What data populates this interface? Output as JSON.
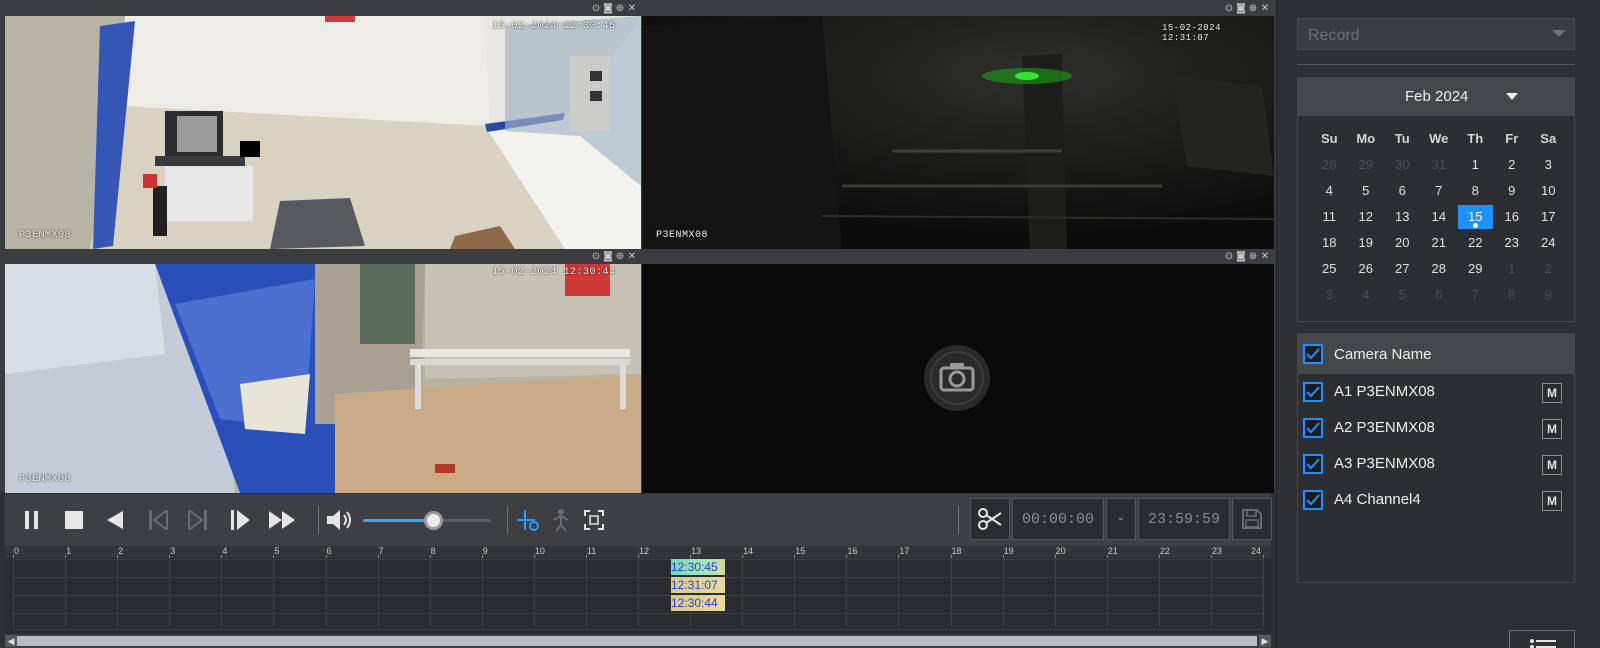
{
  "video": {
    "panes": [
      {
        "timestamp": "15-02-2024 12:30:45",
        "camera": "P3ENMX08"
      },
      {
        "timestamp": "15-02-2024 12:31:07",
        "camera": "P3ENMX08"
      },
      {
        "timestamp": "15-02-2024 12:30:44",
        "camera": "P3ENMX08"
      },
      {
        "timestamp": "",
        "camera": ""
      }
    ],
    "pane_icons": [
      "eye-icon",
      "snapshot-icon",
      "zoom-icon",
      "close-icon"
    ]
  },
  "controls": {
    "volume_level": 0.55,
    "clip_start": "00:00:00",
    "clip_separator": "-",
    "clip_end": "23:59:59"
  },
  "timeline": {
    "hours": [
      "0",
      "1",
      "2",
      "3",
      "4",
      "5",
      "6",
      "7",
      "8",
      "9",
      "10",
      "11",
      "12",
      "13",
      "14",
      "15",
      "16",
      "17",
      "18",
      "19",
      "20",
      "21",
      "22",
      "23",
      "24"
    ],
    "tracks": [
      {
        "label": "12:30:45"
      },
      {
        "label": "12:31:07"
      },
      {
        "label": "12:30:44"
      }
    ]
  },
  "sidebar": {
    "record_select": "Record",
    "calendar": {
      "month": "Feb 2024",
      "weekdays": [
        "Su",
        "Mo",
        "Tu",
        "We",
        "Th",
        "Fr",
        "Sa"
      ],
      "days": [
        [
          "28",
          "29",
          "30",
          "31",
          "1",
          "2",
          "3"
        ],
        [
          "4",
          "5",
          "6",
          "7",
          "8",
          "9",
          "10"
        ],
        [
          "11",
          "12",
          "13",
          "14",
          "15",
          "16",
          "17"
        ],
        [
          "18",
          "19",
          "20",
          "21",
          "22",
          "23",
          "24"
        ],
        [
          "25",
          "26",
          "27",
          "28",
          "29",
          "1",
          "2"
        ],
        [
          "3",
          "4",
          "5",
          "6",
          "7",
          "8",
          "9"
        ]
      ],
      "selected_day": "15"
    },
    "camera_header": "Camera Name",
    "cameras": [
      {
        "name": "A1 P3ENMX08",
        "m": "M"
      },
      {
        "name": "A2 P3ENMX08",
        "m": "M"
      },
      {
        "name": "A3 P3ENMX08",
        "m": "M"
      },
      {
        "name": "A4 Channel4",
        "m": "M"
      }
    ]
  }
}
